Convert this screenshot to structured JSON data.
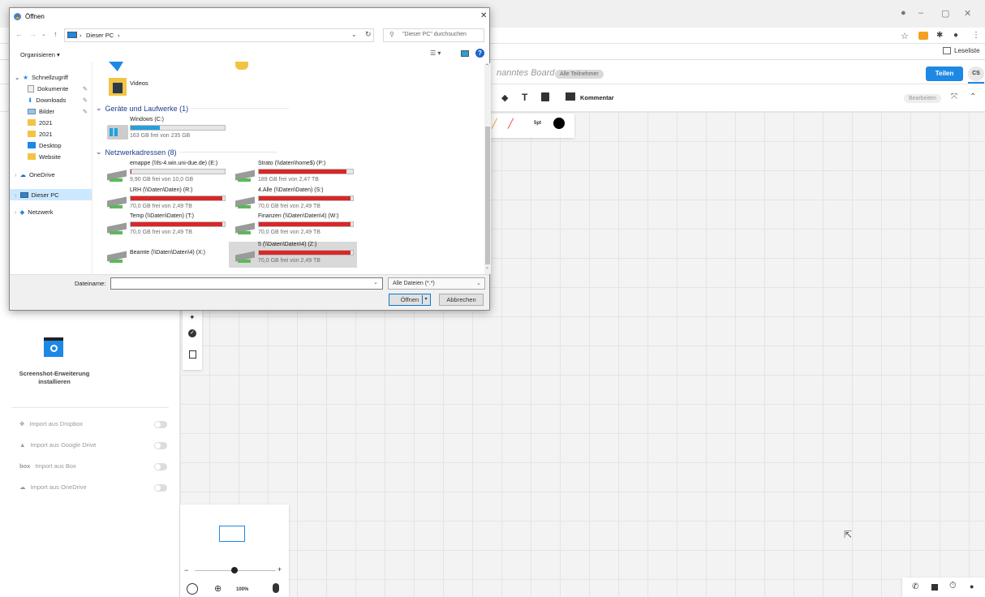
{
  "browser": {
    "bookmark_right": "Leseliste"
  },
  "app": {
    "board_name": "nanntes Board",
    "participants_pill": "Alle Teilnehmer",
    "share_label": "Teilen",
    "avatar_initials": "CS",
    "comment_label": "Kommentar",
    "edit_label": "Bearbeiten",
    "stroke_size": "5pt"
  },
  "left_panel": {
    "screenshot_title": "Screenshot-Erweiterung installieren",
    "imports": [
      {
        "label": "Import aus Dropbox",
        "icon": "dropbox-icon"
      },
      {
        "label": "Import aus Google Drive",
        "icon": "google-drive-icon"
      },
      {
        "label": "Import aus Box",
        "icon": "box-icon"
      },
      {
        "label": "Import aus OneDrive",
        "icon": "onedrive-icon"
      }
    ]
  },
  "zoom": {
    "value": "100%",
    "minus": "−",
    "plus": "+"
  },
  "dialog": {
    "title": "Öffnen",
    "breadcrumb": "Dieser PC",
    "breadcrumb_sep": "›",
    "search_placeholder": "\"Dieser PC\" durchsuchen",
    "organize": "Organisieren ▾",
    "nav": {
      "quick_access": "Schnellzugriff",
      "items": [
        "Dokumente",
        "Downloads",
        "Bilder",
        "2021",
        "2021",
        "Desktop",
        "Website"
      ],
      "onedrive": "OneDrive",
      "this_pc": "Dieser PC",
      "network": "Netzwerk"
    },
    "videos_label": "Videos",
    "devices_header": "Geräte und Laufwerke (1)",
    "windows_drive": {
      "name": "Windows (C:)",
      "free": "163 GB frei von 235 GB",
      "fill": 0.31
    },
    "network_header": "Netzwerkadressen (8)",
    "network_drives": [
      {
        "name": "emappe (\\\\fs-4.win.uni-due.de) (E:)",
        "free": "9,90 GB frei von 10,0 GB",
        "fill": 0.01
      },
      {
        "name": "Strato (\\\\daten\\home$) (P:)",
        "free": "189 GB frei von 2,47 TB",
        "fill": 0.93
      },
      {
        "name": "LRH (\\\\Daten\\Daten) (R:)",
        "free": "70,0 GB frei von 2,49 TB",
        "fill": 0.97
      },
      {
        "name": "4.Alle (\\\\Daten\\Daten) (S:)",
        "free": "70,0 GB frei von 2,49 TB",
        "fill": 0.97
      },
      {
        "name": "Temp (\\\\Daten\\Daten) (T:)",
        "free": "70,0 GB frei von 2,49 TB",
        "fill": 0.97
      },
      {
        "name": "Finanzen (\\\\Daten\\Daten\\4) (W:)",
        "free": "70,0 GB frei von 2,49 TB",
        "fill": 0.97
      },
      {
        "name": "Beamte (\\\\Daten\\Daten\\4) (X:)",
        "free": "",
        "fill": 0
      },
      {
        "name": "5 (\\\\Daten\\Daten\\4) (Z:)",
        "free": "70,0 GB frei von 2,49 TB",
        "fill": 0.97
      }
    ],
    "filename_label": "Dateiname:",
    "filename_value": "",
    "filter": "Alle Dateien (*.*)",
    "open_label": "Öffnen",
    "cancel_label": "Abbrechen"
  },
  "colors": {
    "accent": "#1e88e5",
    "drive_full": "#da2626",
    "drive_ok": "#26a0da"
  }
}
